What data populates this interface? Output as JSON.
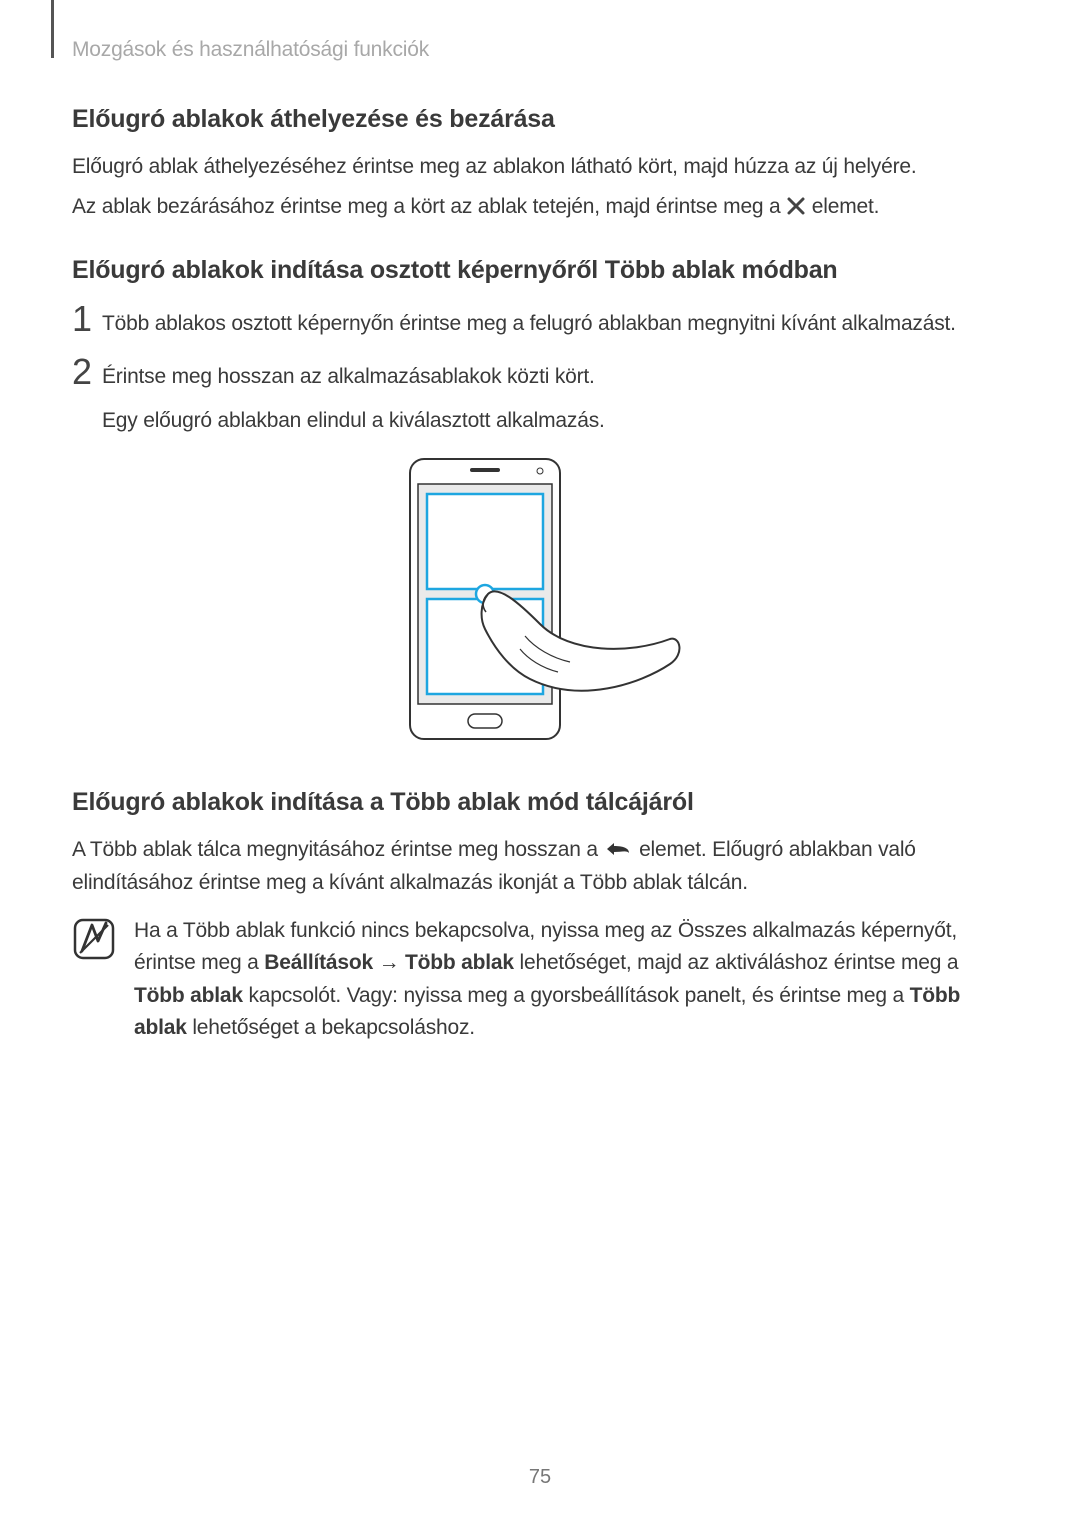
{
  "header": {
    "breadcrumb": "Mozgások és használhatósági funkciók"
  },
  "section1": {
    "heading": "Előugró ablakok áthelyezése és bezárása",
    "p1": "Előugró ablak áthelyezéséhez érintse meg az ablakon látható kört, majd húzza az új helyére.",
    "p2_a": "Az ablak bezárásához érintse meg a kört az ablak tetején, majd érintse meg a ",
    "p2_b": " elemet."
  },
  "section2": {
    "heading": "Előugró ablakok indítása osztott képernyőről Több ablak módban",
    "steps": [
      {
        "num": "1",
        "text": "Több ablakos osztott képernyőn érintse meg a felugró ablakban megnyitni kívánt alkalmazást."
      },
      {
        "num": "2",
        "text1": "Érintse meg hosszan az alkalmazásablakok közti kört.",
        "text2": "Egy előugró ablakban elindul a kiválasztott alkalmazás."
      }
    ]
  },
  "section3": {
    "heading": "Előugró ablakok indítása a Több ablak mód tálcájáról",
    "p1_a": "A Több ablak tálca megnyitásához érintse meg hosszan a ",
    "p1_b": " elemet. Előugró ablakban való elindításához érintse meg a kívánt alkalmazás ikonját a Több ablak tálcán.",
    "note_a": "Ha a Több ablak funkció nincs bekapcsolva, nyissa meg az Összes alkalmazás képernyőt, érintse meg a ",
    "note_b": "Beállítások",
    "note_c": "Több ablak",
    "note_d": " lehetőséget, majd az aktiváláshoz érintse meg a ",
    "note_e": "Több ablak",
    "note_f": " kapcsolót. Vagy: nyissa meg a gyorsbeállítások panelt, és érintse meg a ",
    "note_g": "Több ablak",
    "note_h": " lehetőséget a bekapcsoláshoz."
  },
  "page_number": "75"
}
